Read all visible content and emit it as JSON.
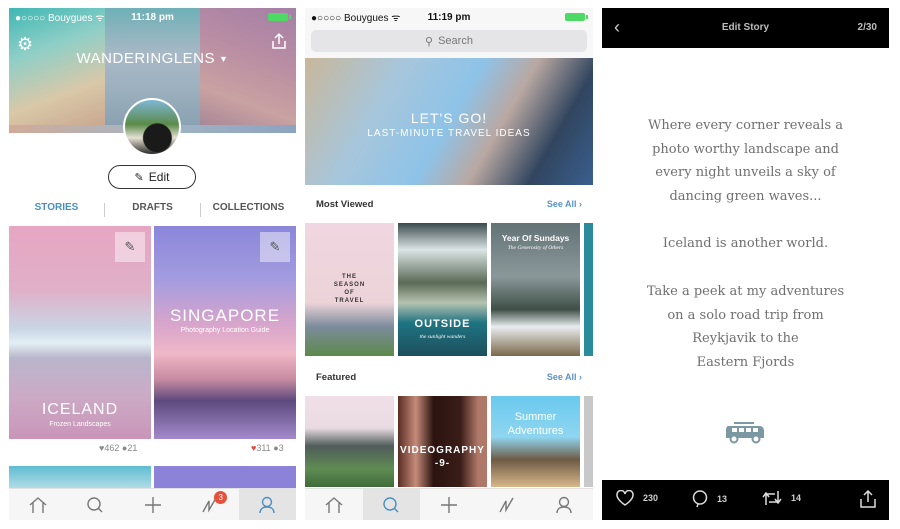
{
  "profile_screen": {
    "status_bar": {
      "carrier": "●○○○○ Bouygues ᯤ",
      "time": "11:18 pm"
    },
    "icons": {
      "settings": "gear-icon",
      "share": "share-icon"
    },
    "username": "WANDERINGLENS",
    "username_caret": "▼",
    "edit_button": {
      "icon": "✎",
      "label": "Edit"
    },
    "tabs": [
      {
        "label": "STORIES",
        "active": true
      },
      {
        "label": "DRAFTS",
        "active": false
      },
      {
        "label": "COLLECTIONS",
        "active": false
      }
    ],
    "stories": [
      {
        "title": "ICELAND",
        "subtitle": "Frozen Landscapes",
        "likes": "462",
        "comments": "21",
        "liked": false
      },
      {
        "title": "SINGAPORE",
        "subtitle": "Photography Location Guide",
        "likes": "311",
        "comments": "3",
        "liked": true
      }
    ],
    "tab_bar": {
      "items": [
        "home",
        "search",
        "create",
        "activity",
        "profile"
      ],
      "active": "profile",
      "activity_badge": "3"
    }
  },
  "explore_screen": {
    "status_bar": {
      "carrier": "●○○○○ Bouygues ᯤ",
      "time": "11:19 pm"
    },
    "search": {
      "placeholder": "Search"
    },
    "hero": {
      "title": "LET'S GO!",
      "subtitle": "LAST-MINUTE TRAVEL IDEAS"
    },
    "most_viewed": {
      "title": "Most Viewed",
      "see_all": "See All ›",
      "items": [
        {
          "title": "THE\nSEASON\nOF\nTRAVEL",
          "subtitle": ""
        },
        {
          "title": "OUTSIDE",
          "subtitle": "the sunlight wanders"
        },
        {
          "title": "Year Of Sundays",
          "subtitle": "The Generosity of Others"
        }
      ]
    },
    "featured": {
      "title": "Featured",
      "see_all": "See All ›",
      "items": [
        {
          "title": ""
        },
        {
          "title": "VIDEOGRAPHY\n-9-"
        },
        {
          "title": "Summer\nAdventures"
        }
      ]
    },
    "tab_bar": {
      "active": "search"
    }
  },
  "edit_story_screen": {
    "header": {
      "back": "‹",
      "title": "Edit Story",
      "page": "2/30"
    },
    "paragraphs": [
      "Where every corner reveals a\nphoto worthy landscape and\nevery night unveils a sky of\ndancing green waves...",
      "Iceland is another world.",
      "Take a peek at my adventures\non a solo road trip from\nReykjavik to the\nEastern Fjords"
    ],
    "footer": {
      "likes": "230",
      "comments": "13",
      "reposts": "14"
    }
  },
  "colors": {
    "accent": "#4a8fc0",
    "badge": "#e8503a",
    "battery": "#4cd964",
    "heart_liked": "#e0443e"
  }
}
